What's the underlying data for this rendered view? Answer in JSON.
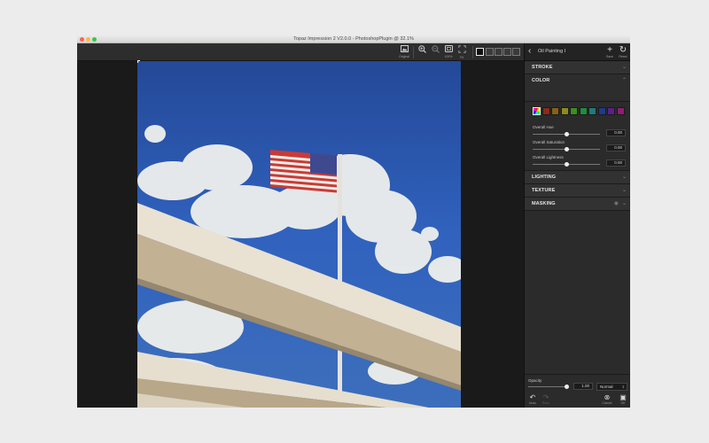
{
  "window": {
    "title": "Topaz Impression 2 V2.0.0 - PhotoshopPlugin @ 32.1%"
  },
  "toolbar": {
    "original_label": "Original",
    "zoom_in_label": "",
    "zoom_out_label": "",
    "zoom_100_label": "100%",
    "fit_label": "Fit"
  },
  "panel": {
    "preset_name": "Oil Painting I",
    "save_label": "Save",
    "reset_label": "Reset",
    "sections": {
      "stroke": "STROKE",
      "color": "COLOR",
      "lighting": "LIGHTING",
      "texture": "TEXTURE",
      "masking": "MASKING"
    },
    "swatch_colors": [
      "rainbow",
      "#8c2a1c",
      "#8a5f1a",
      "#8c8c1a",
      "#3f8c1f",
      "#1f8c3f",
      "#1f7b7b",
      "#1f3a8c",
      "#5a1f8c",
      "#8c1f6e"
    ],
    "adjustments": [
      {
        "label": "Overall Hue",
        "value": "0.00",
        "position": 0.5
      },
      {
        "label": "Overall Saturation",
        "value": "0.00",
        "position": 0.5
      },
      {
        "label": "Overall Lightness",
        "value": "0.00",
        "position": 0.5
      }
    ]
  },
  "footer": {
    "opacity_label": "Opacity",
    "opacity_value": "1.00",
    "opacity_position": 1.0,
    "blend_mode": "Normal",
    "undo_label": "Undo",
    "redo_label": "Redo",
    "cancel_label": "Cancel",
    "ok_label": "OK"
  },
  "colors": {
    "accent": "#e8e8e8",
    "panel_bg": "#2b2b2b",
    "sky": "#1750bd"
  }
}
